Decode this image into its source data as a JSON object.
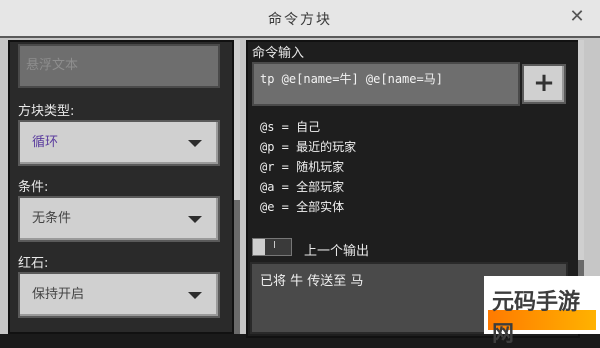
{
  "window": {
    "title": "命令方块"
  },
  "left_panel": {
    "description_placeholder": "悬浮文本",
    "block_type": {
      "label": "方块类型:",
      "value": "循环"
    },
    "condition": {
      "label": "条件:",
      "value": "无条件"
    },
    "redstone": {
      "label": "红石:",
      "value": "保持开启"
    }
  },
  "right_panel": {
    "command_input_label": "命令输入",
    "command_text": "tp @e[name=牛] @e[name=马]",
    "add_button_label": "+",
    "hints": [
      "@s = 自己",
      "@p = 最近的玩家",
      "@r = 随机玩家",
      "@a = 全部玩家",
      "@e = 全部实体"
    ],
    "previous_output_label": "上一个输出",
    "toggle_glyph": "I",
    "output_text": "已将 牛 传送至 马"
  },
  "watermark": {
    "text": "元码手游网"
  },
  "colors": {
    "window_bg": "#c6c6c6",
    "panel_bg": "#2a2a2a",
    "dropdown_bg": "#d0d0d0",
    "block_type_value": "#5b3d9e"
  },
  "icons": {
    "close": "close-icon",
    "caret": "chevron-down-icon",
    "add": "plus-icon"
  }
}
